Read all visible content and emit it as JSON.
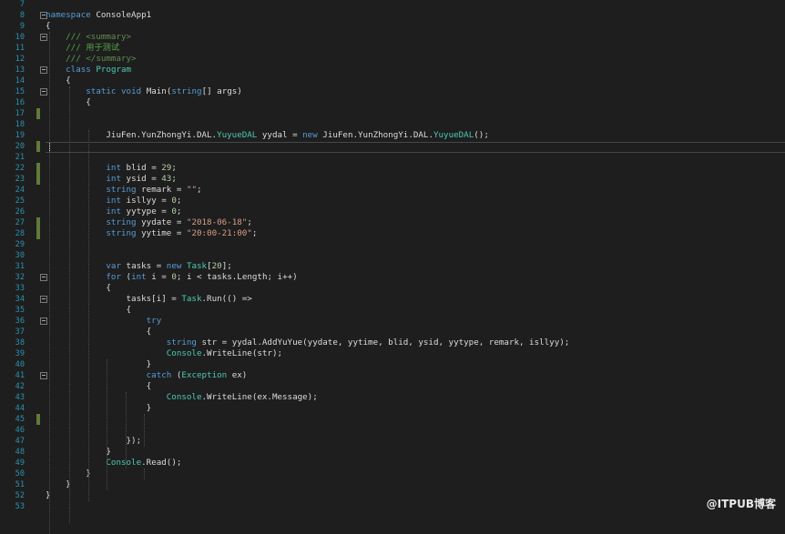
{
  "editor": {
    "lines": [
      {
        "n": "7",
        "tokens": []
      },
      {
        "n": "8",
        "fold": true,
        "tokens": [
          {
            "t": "namespace",
            "c": "kw"
          },
          {
            "t": " ConsoleApp1",
            "c": "tx"
          }
        ]
      },
      {
        "n": "9",
        "tokens": [
          {
            "t": "{",
            "c": "tx"
          }
        ]
      },
      {
        "n": "10",
        "fold": true,
        "tokens": [
          {
            "t": "    /// ",
            "c": "cm"
          },
          {
            "t": "<summary>",
            "c": "xml"
          }
        ]
      },
      {
        "n": "11",
        "tokens": [
          {
            "t": "    /// 用于测试",
            "c": "cm"
          }
        ]
      },
      {
        "n": "12",
        "tokens": [
          {
            "t": "    /// ",
            "c": "cm"
          },
          {
            "t": "</summary>",
            "c": "xml"
          }
        ]
      },
      {
        "n": "13",
        "fold": true,
        "tokens": [
          {
            "t": "    ",
            "c": "tx"
          },
          {
            "t": "class",
            "c": "kw"
          },
          {
            "t": " ",
            "c": "tx"
          },
          {
            "t": "Program",
            "c": "ty"
          }
        ]
      },
      {
        "n": "14",
        "tokens": [
          {
            "t": "    {",
            "c": "tx"
          }
        ]
      },
      {
        "n": "15",
        "fold": true,
        "tokens": [
          {
            "t": "        ",
            "c": "tx"
          },
          {
            "t": "static",
            "c": "kw"
          },
          {
            "t": " ",
            "c": "tx"
          },
          {
            "t": "void",
            "c": "kw"
          },
          {
            "t": " Main(",
            "c": "tx"
          },
          {
            "t": "string",
            "c": "kw"
          },
          {
            "t": "[] args)",
            "c": "tx"
          }
        ]
      },
      {
        "n": "16",
        "tokens": [
          {
            "t": "        {",
            "c": "tx"
          }
        ]
      },
      {
        "n": "17",
        "changed": true,
        "tokens": []
      },
      {
        "n": "18",
        "tokens": []
      },
      {
        "n": "19",
        "tokens": [
          {
            "t": "            JiuFen.YunZhongYi.DAL.",
            "c": "tx"
          },
          {
            "t": "YuyueDAL",
            "c": "ty"
          },
          {
            "t": " yydal = ",
            "c": "tx"
          },
          {
            "t": "new",
            "c": "kw"
          },
          {
            "t": " JiuFen.YunZhongYi.DAL.",
            "c": "tx"
          },
          {
            "t": "YuyueDAL",
            "c": "ty"
          },
          {
            "t": "();",
            "c": "tx"
          }
        ]
      },
      {
        "n": "20",
        "changed": true,
        "current": true,
        "tokens": []
      },
      {
        "n": "21",
        "tokens": []
      },
      {
        "n": "22",
        "changed": true,
        "tokens": [
          {
            "t": "            ",
            "c": "tx"
          },
          {
            "t": "int",
            "c": "kw"
          },
          {
            "t": " blid = ",
            "c": "tx"
          },
          {
            "t": "29",
            "c": "num"
          },
          {
            "t": ";",
            "c": "tx"
          }
        ]
      },
      {
        "n": "23",
        "changed": true,
        "tokens": [
          {
            "t": "            ",
            "c": "tx"
          },
          {
            "t": "int",
            "c": "kw"
          },
          {
            "t": " ysid = ",
            "c": "tx"
          },
          {
            "t": "43",
            "c": "num"
          },
          {
            "t": ";",
            "c": "tx"
          }
        ]
      },
      {
        "n": "24",
        "tokens": [
          {
            "t": "            ",
            "c": "tx"
          },
          {
            "t": "string",
            "c": "kw"
          },
          {
            "t": " remark = ",
            "c": "tx"
          },
          {
            "t": "\"\"",
            "c": "str"
          },
          {
            "t": ";",
            "c": "tx"
          }
        ]
      },
      {
        "n": "25",
        "tokens": [
          {
            "t": "            ",
            "c": "tx"
          },
          {
            "t": "int",
            "c": "kw"
          },
          {
            "t": " isllyy = ",
            "c": "tx"
          },
          {
            "t": "0",
            "c": "num"
          },
          {
            "t": ";",
            "c": "tx"
          }
        ]
      },
      {
        "n": "26",
        "tokens": [
          {
            "t": "            ",
            "c": "tx"
          },
          {
            "t": "int",
            "c": "kw"
          },
          {
            "t": " yytype = ",
            "c": "tx"
          },
          {
            "t": "0",
            "c": "num"
          },
          {
            "t": ";",
            "c": "tx"
          }
        ]
      },
      {
        "n": "27",
        "changed": true,
        "tokens": [
          {
            "t": "            ",
            "c": "tx"
          },
          {
            "t": "string",
            "c": "kw"
          },
          {
            "t": " yydate = ",
            "c": "tx"
          },
          {
            "t": "\"2018-06-18\"",
            "c": "str"
          },
          {
            "t": ";",
            "c": "tx"
          }
        ]
      },
      {
        "n": "28",
        "changed": true,
        "tokens": [
          {
            "t": "            ",
            "c": "tx"
          },
          {
            "t": "string",
            "c": "kw"
          },
          {
            "t": " yytime = ",
            "c": "tx"
          },
          {
            "t": "\"20:00-21:00\"",
            "c": "str"
          },
          {
            "t": ";",
            "c": "tx"
          }
        ]
      },
      {
        "n": "29",
        "tokens": []
      },
      {
        "n": "30",
        "tokens": []
      },
      {
        "n": "31",
        "tokens": [
          {
            "t": "            ",
            "c": "tx"
          },
          {
            "t": "var",
            "c": "kw"
          },
          {
            "t": " tasks = ",
            "c": "tx"
          },
          {
            "t": "new",
            "c": "kw"
          },
          {
            "t": " ",
            "c": "tx"
          },
          {
            "t": "Task",
            "c": "ty"
          },
          {
            "t": "[",
            "c": "tx"
          },
          {
            "t": "20",
            "c": "num"
          },
          {
            "t": "];",
            "c": "tx"
          }
        ]
      },
      {
        "n": "32",
        "fold": true,
        "tokens": [
          {
            "t": "            ",
            "c": "tx"
          },
          {
            "t": "for",
            "c": "kw"
          },
          {
            "t": " (",
            "c": "tx"
          },
          {
            "t": "int",
            "c": "kw"
          },
          {
            "t": " i = ",
            "c": "tx"
          },
          {
            "t": "0",
            "c": "num"
          },
          {
            "t": "; i < tasks.Length; i++)",
            "c": "tx"
          }
        ]
      },
      {
        "n": "33",
        "tokens": [
          {
            "t": "            {",
            "c": "tx"
          }
        ]
      },
      {
        "n": "34",
        "fold": true,
        "tokens": [
          {
            "t": "                tasks[i] = ",
            "c": "tx"
          },
          {
            "t": "Task",
            "c": "ty"
          },
          {
            "t": ".Run(() =>",
            "c": "tx"
          }
        ]
      },
      {
        "n": "35",
        "tokens": [
          {
            "t": "                {",
            "c": "tx"
          }
        ]
      },
      {
        "n": "36",
        "fold": true,
        "tokens": [
          {
            "t": "                    ",
            "c": "tx"
          },
          {
            "t": "try",
            "c": "kw"
          }
        ]
      },
      {
        "n": "37",
        "tokens": [
          {
            "t": "                    {",
            "c": "tx"
          }
        ]
      },
      {
        "n": "38",
        "tokens": [
          {
            "t": "                        ",
            "c": "tx"
          },
          {
            "t": "string",
            "c": "kw"
          },
          {
            "t": " str = yydal.AddYuYue(yydate, yytime, blid, ysid, yytype, remark, isllyy);",
            "c": "tx"
          }
        ]
      },
      {
        "n": "39",
        "tokens": [
          {
            "t": "                        ",
            "c": "tx"
          },
          {
            "t": "Console",
            "c": "ty"
          },
          {
            "t": ".WriteLine(str);",
            "c": "tx"
          }
        ]
      },
      {
        "n": "40",
        "tokens": [
          {
            "t": "                    }",
            "c": "tx"
          }
        ]
      },
      {
        "n": "41",
        "fold": true,
        "tokens": [
          {
            "t": "                    ",
            "c": "tx"
          },
          {
            "t": "catch",
            "c": "kw"
          },
          {
            "t": " (",
            "c": "tx"
          },
          {
            "t": "Exception",
            "c": "ty"
          },
          {
            "t": " ex)",
            "c": "tx"
          }
        ]
      },
      {
        "n": "42",
        "tokens": [
          {
            "t": "                    {",
            "c": "tx"
          }
        ]
      },
      {
        "n": "43",
        "tokens": [
          {
            "t": "                        ",
            "c": "tx"
          },
          {
            "t": "Console",
            "c": "ty"
          },
          {
            "t": ".WriteLine(ex.Message);",
            "c": "tx"
          }
        ]
      },
      {
        "n": "44",
        "tokens": [
          {
            "t": "                    }",
            "c": "tx"
          }
        ]
      },
      {
        "n": "45",
        "changed": true,
        "tokens": []
      },
      {
        "n": "46",
        "tokens": []
      },
      {
        "n": "47",
        "tokens": [
          {
            "t": "                });",
            "c": "tx"
          }
        ]
      },
      {
        "n": "48",
        "tokens": [
          {
            "t": "            }",
            "c": "tx"
          }
        ]
      },
      {
        "n": "49",
        "tokens": [
          {
            "t": "            ",
            "c": "tx"
          },
          {
            "t": "Console",
            "c": "ty"
          },
          {
            "t": ".Read();",
            "c": "tx"
          }
        ]
      },
      {
        "n": "50",
        "tokens": [
          {
            "t": "        }",
            "c": "tx"
          }
        ]
      },
      {
        "n": "51",
        "tokens": [
          {
            "t": "    }",
            "c": "tx"
          }
        ]
      },
      {
        "n": "52",
        "tokens": [
          {
            "t": "}",
            "c": "tx"
          }
        ]
      },
      {
        "n": "53",
        "tokens": []
      }
    ]
  },
  "watermark": "@ITPUB博客",
  "colors": {
    "background": "#1e1e1e",
    "keyword": "#569cd6",
    "type": "#4ec9b0",
    "string": "#d69d85",
    "number": "#b5cea8",
    "comment": "#57a64a",
    "line_number": "#2b91af",
    "change_marker": "#5f7b37"
  }
}
